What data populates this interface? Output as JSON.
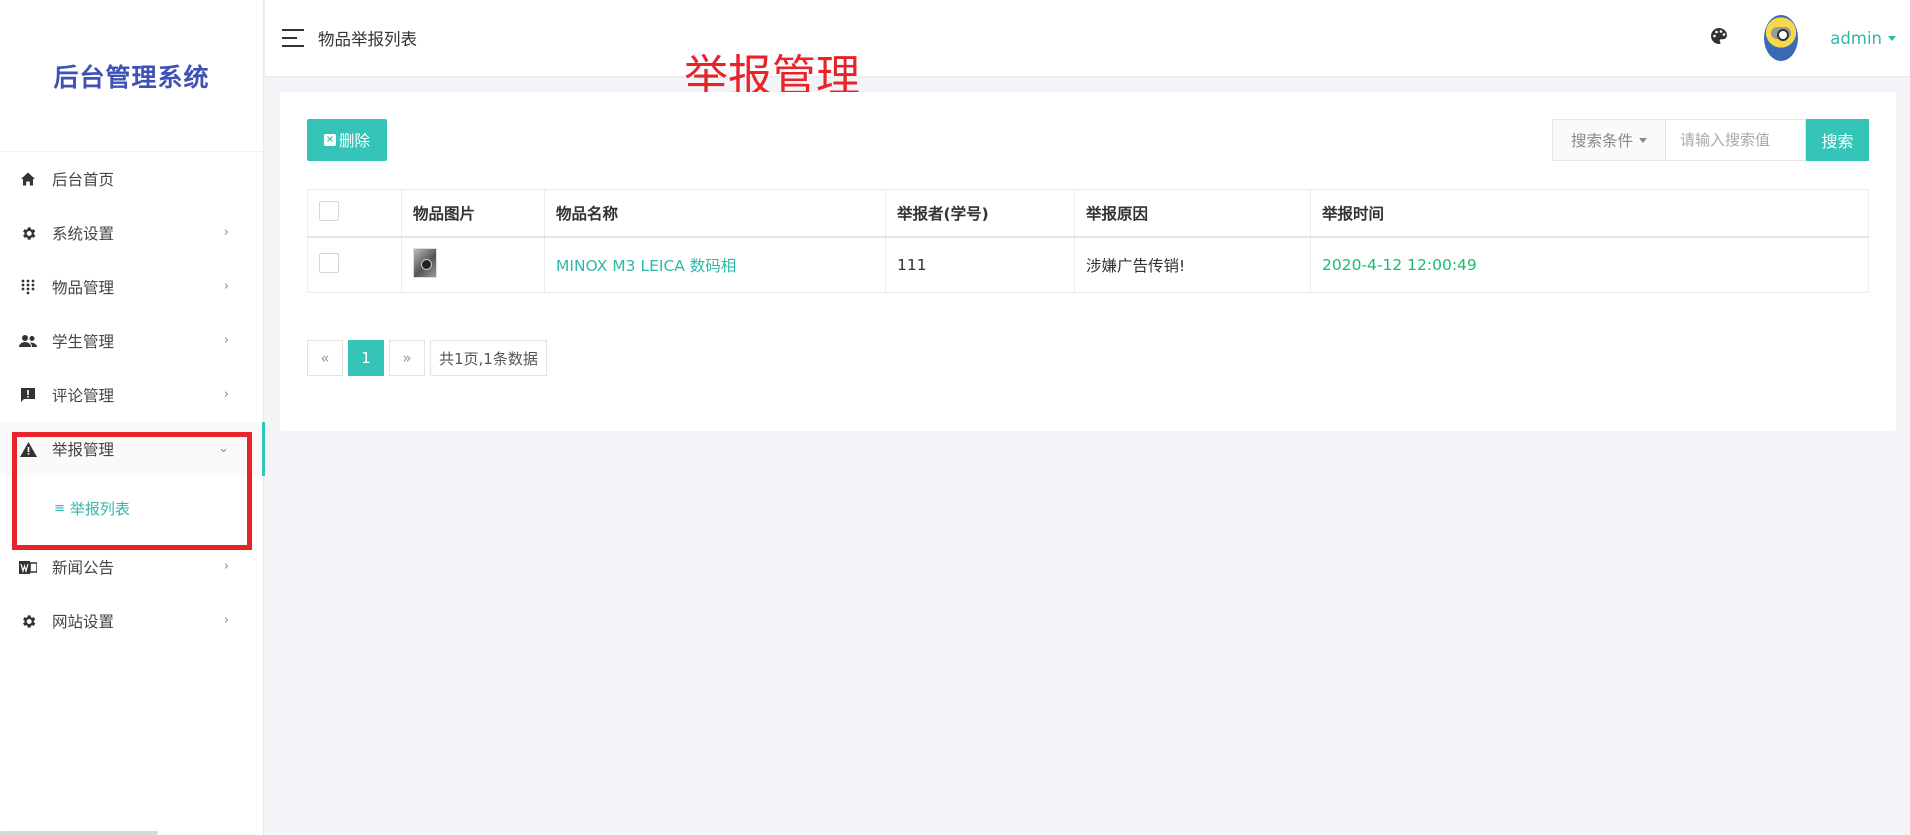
{
  "sidebar": {
    "logo": "后台管理系统",
    "items": [
      {
        "label": "后台首页",
        "icon": "home-icon"
      },
      {
        "label": "系统设置",
        "icon": "gear-icon"
      },
      {
        "label": "物品管理",
        "icon": "grid-dots-icon"
      },
      {
        "label": "学生管理",
        "icon": "people-icon"
      },
      {
        "label": "评论管理",
        "icon": "comment-alert-icon"
      },
      {
        "label": "举报管理",
        "icon": "warning-icon"
      },
      {
        "label": "新闻公告",
        "icon": "news-icon"
      },
      {
        "label": "网站设置",
        "icon": "gear-icon"
      }
    ],
    "submenu": {
      "label": "举报列表",
      "icon": "list-icon"
    }
  },
  "topbar": {
    "tab": "物品举报列表",
    "overlay_title": "举报管理",
    "user": "admin"
  },
  "toolbar": {
    "delete_label": "删除",
    "search_condition": "搜索条件",
    "search_placeholder": "请输入搜索值",
    "search_label": "搜索"
  },
  "table": {
    "headers": [
      "物品图片",
      "物品名称",
      "举报者(学号)",
      "举报原因",
      "举报时间"
    ],
    "rows": [
      {
        "name": "MINOX M3 LEICA 数码相",
        "reporter": "111",
        "reason": "涉嫌广告传销!",
        "time": "2020-4-12 12:00:49"
      }
    ]
  },
  "pager": {
    "prev": "«",
    "current": "1",
    "next": "»",
    "info": "共1页,1条数据"
  },
  "colors": {
    "accent": "#34c4b8",
    "logo": "#3f51b5",
    "highlight": "#e8242b",
    "time": "#19be6b"
  }
}
